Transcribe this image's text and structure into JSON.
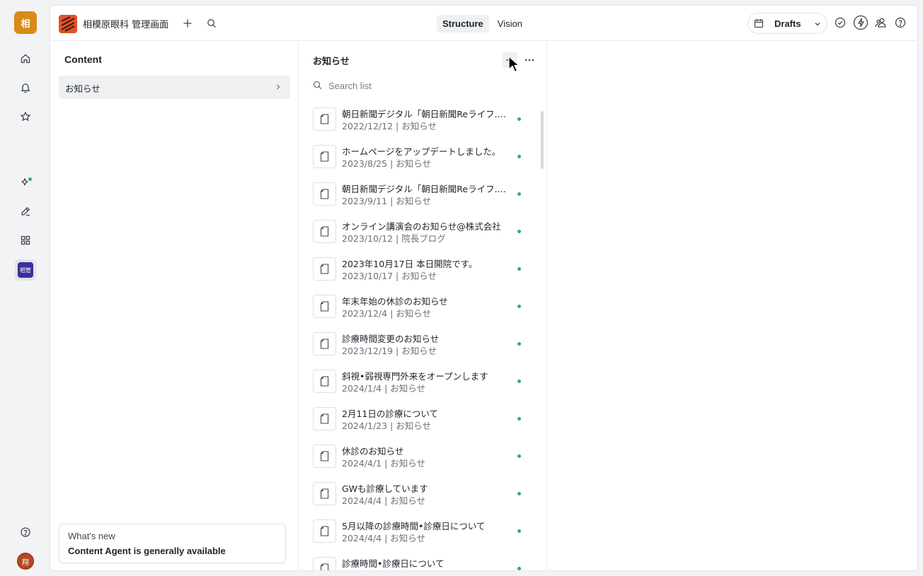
{
  "rail": {
    "workspace_initial": "相",
    "project_badge": "相管",
    "user_initial": "翔",
    "icons": [
      "home-icon",
      "bell-icon",
      "star-icon",
      "sparkle-icon",
      "pen-icon",
      "grid-icon",
      "help-icon"
    ]
  },
  "topbar": {
    "workspace_name": "相模原眼科 管理画面",
    "tabs": [
      {
        "label": "Structure",
        "active": true
      },
      {
        "label": "Vision",
        "active": false
      }
    ],
    "release_label": "Drafts"
  },
  "structure": {
    "title": "Content",
    "items": [
      {
        "label": "お知らせ"
      }
    ]
  },
  "whats_new": {
    "heading": "What's new",
    "message": "Content Agent is generally available"
  },
  "doc_list": {
    "title": "お知らせ",
    "search_placeholder": "Search list",
    "items": [
      {
        "title": "朝日新聞デジタル「朝日新聞Reライフ.net」に当院の記事が掲載されました",
        "subtitle": "2022/12/12 | お知らせ"
      },
      {
        "title": "ホームページをアップデートしました。",
        "subtitle": "2023/8/25 | お知らせ"
      },
      {
        "title": "朝日新聞デジタル「朝日新聞Reライフ.net」に当院の記事が掲載されました",
        "subtitle": "2023/9/11 | お知らせ"
      },
      {
        "title": "オンライン講演会のお知らせ@株式会社",
        "subtitle": "2023/10/12 | 院長ブログ"
      },
      {
        "title": "2023年10月17日 本日開院です。",
        "subtitle": "2023/10/17 | お知らせ"
      },
      {
        "title": "年末年始の休診のお知らせ",
        "subtitle": "2023/12/4 | お知らせ"
      },
      {
        "title": "診療時間変更のお知らせ",
        "subtitle": "2023/12/19 | お知らせ"
      },
      {
        "title": "斜視•弱視専門外来をオープンします",
        "subtitle": "2024/1/4 | お知らせ"
      },
      {
        "title": "2月11日の診療について",
        "subtitle": "2024/1/23 | お知らせ"
      },
      {
        "title": "休診のお知らせ",
        "subtitle": "2024/4/1 | お知らせ"
      },
      {
        "title": "GWも診療しています",
        "subtitle": "2024/4/4 | お知らせ"
      },
      {
        "title": "5月以降の診療時間•診療日について",
        "subtitle": "2024/4/4 | お知らせ"
      },
      {
        "title": "診療時間•診療日について",
        "subtitle": ""
      }
    ]
  },
  "colors": {
    "workspace_badge": "#d88b16",
    "project_badge": "#3b2f9a",
    "published_dot": "#3aa776"
  }
}
